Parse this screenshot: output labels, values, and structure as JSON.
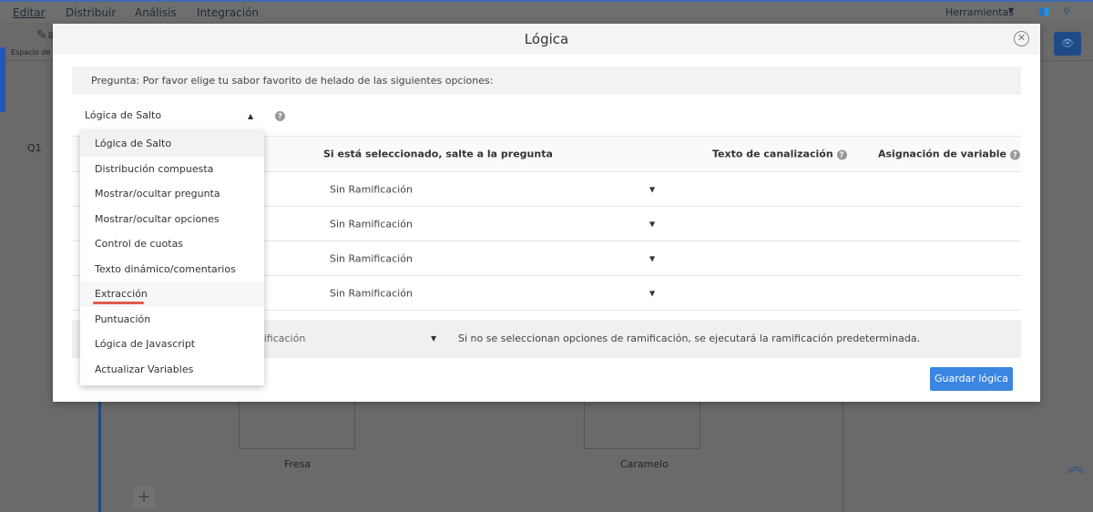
{
  "nav": {
    "items": [
      "Editar",
      "Distribuir",
      "Análisis",
      "Integración"
    ],
    "tools": "Herramientas",
    "collab_count": "0"
  },
  "toolbar": {
    "workspace": "Espacio de"
  },
  "survey": {
    "q_label": "Q1",
    "options": [
      "Fresa",
      "Caramelo"
    ]
  },
  "modal": {
    "title": "Lógica",
    "question": "Pregunta: Por favor elige tu sabor favorito de helado de las siguientes opciones:",
    "logic_type": "Lógica de Salto",
    "headers": {
      "jump": "Si está seleccionado, salte a la pregunta",
      "piping": "Texto de canalización",
      "variable": "Asignación de variable"
    },
    "rows": [
      "Sin Ramificación",
      "Sin Ramificación",
      "Sin Ramificación",
      "Sin Ramificación"
    ],
    "default_value": "mificación",
    "default_note": "Si no se seleccionan opciones de ramificación, se ejecutará la ramificación predeterminada.",
    "save": "Guardar lógica"
  },
  "menu": [
    "Lógica de Salto",
    "Distribución compuesta",
    "Mostrar/ocultar pregunta",
    "Mostrar/ocultar opciones",
    "Control de cuotas",
    "Texto dinámico/comentarios",
    "Extracción",
    "Puntuación",
    "Lógica de Javascript",
    "Actualizar Variables"
  ],
  "colors": {
    "accent": "#3b86e0",
    "highlight": "#e05a4a"
  }
}
